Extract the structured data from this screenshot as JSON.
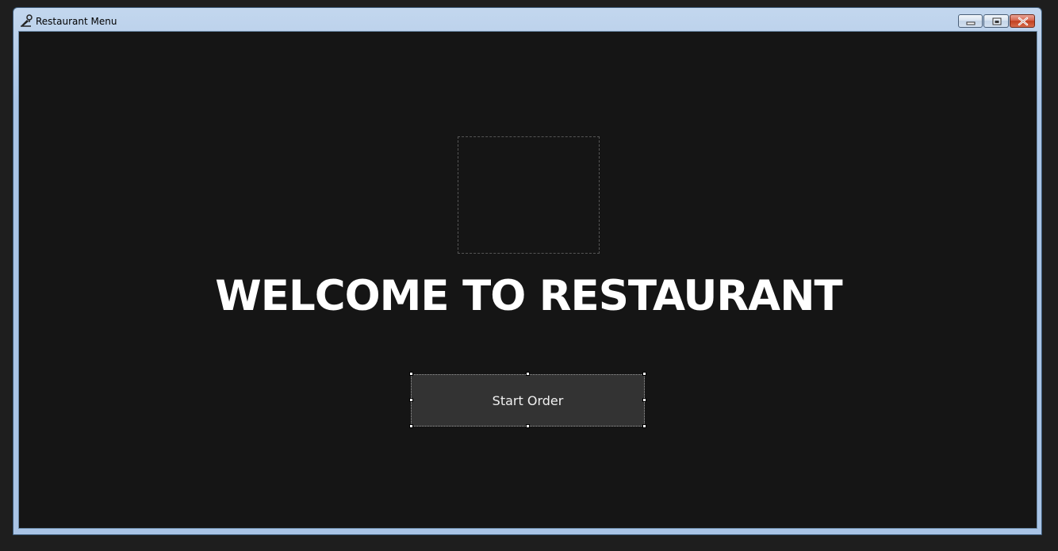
{
  "window": {
    "title": "Restaurant Menu",
    "app_icon": "designer-icon",
    "accent_frame_color": "#a9c4e6",
    "client_background": "#151515"
  },
  "caption_buttons": {
    "minimize_icon": "minimize-icon",
    "maximize_icon": "restore-icon",
    "close_icon": "close-icon"
  },
  "main": {
    "image_placeholder": "empty-picture-box",
    "welcome_text": "WELCOME TO RESTAURANT",
    "start_button_label": "Start Order",
    "start_button_background": "#333333"
  }
}
